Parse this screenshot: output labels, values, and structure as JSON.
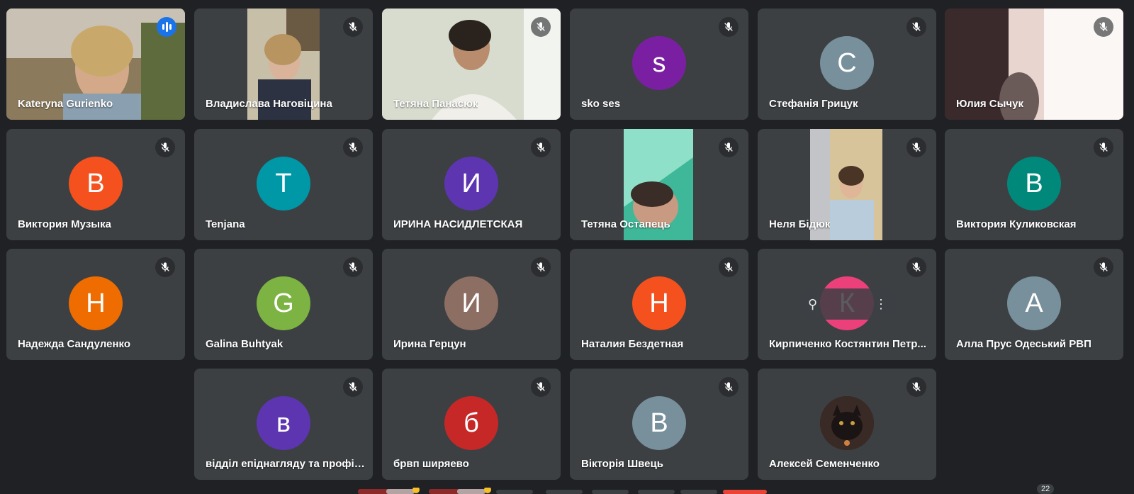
{
  "participants": [
    {
      "name": "Kateryna Gurienko",
      "initial": "",
      "color": "",
      "type": "video",
      "speaking": true
    },
    {
      "name": "Владислава Наговіцина",
      "initial": "",
      "color": "",
      "type": "video"
    },
    {
      "name": "Тетяна Панасюк",
      "initial": "",
      "color": "",
      "type": "video"
    },
    {
      "name": "sko ses",
      "initial": "s",
      "color": "#7b1fa2",
      "type": "avatar"
    },
    {
      "name": "Стефанія Грицук",
      "initial": "С",
      "color": "#78909c",
      "type": "avatar"
    },
    {
      "name": "Юлия Сычук",
      "initial": "",
      "color": "",
      "type": "video"
    },
    {
      "name": "Виктория Музыка",
      "initial": "В",
      "color": "#f4511e",
      "type": "avatar"
    },
    {
      "name": "Tenjana",
      "initial": "T",
      "color": "#0097a7",
      "type": "avatar"
    },
    {
      "name": "ИРИНА НАСИДЛЕТСКАЯ",
      "initial": "И",
      "color": "#5e35b1",
      "type": "avatar"
    },
    {
      "name": "Тетяна Остапець",
      "initial": "",
      "color": "",
      "type": "video"
    },
    {
      "name": "Неля Бідюк",
      "initial": "",
      "color": "",
      "type": "video"
    },
    {
      "name": "Виктория Куликовская",
      "initial": "В",
      "color": "#00897b",
      "type": "avatar"
    },
    {
      "name": "Надежда Сандуленко",
      "initial": "Н",
      "color": "#ef6c00",
      "type": "avatar"
    },
    {
      "name": "Galina Buhtyak",
      "initial": "G",
      "color": "#7cb342",
      "type": "avatar"
    },
    {
      "name": "Ирина Герцун",
      "initial": "И",
      "color": "#8d6e63",
      "type": "avatar"
    },
    {
      "name": "Наталия Бездетная",
      "initial": "Н",
      "color": "#f4511e",
      "type": "avatar"
    },
    {
      "name": "Кирпиченко Костянтин Петр...",
      "initial": "К",
      "color": "#ec407a",
      "type": "avatar",
      "hovered": true
    },
    {
      "name": "Алла Прус Одеський РВП",
      "initial": "А",
      "color": "#78909c",
      "type": "avatar"
    },
    {
      "name": "відділ епіднагляду та профіл...",
      "initial": "в",
      "color": "#5e35b1",
      "type": "avatar"
    },
    {
      "name": "брвп ширяево",
      "initial": "б",
      "color": "#c62828",
      "type": "avatar"
    },
    {
      "name": "Вікторія Швець",
      "initial": "В",
      "color": "#78909c",
      "type": "avatar"
    },
    {
      "name": "Алексей Семенченко",
      "initial": "",
      "color": "",
      "type": "photo"
    }
  ],
  "hover_controls": {
    "pin_glyph": "⚲",
    "more_glyph": "⋮"
  },
  "participant_count": "22",
  "colors": {
    "background": "#202124",
    "tile": "#3c4043",
    "accent": "#8ab4f8",
    "speaking": "#1a73e8"
  }
}
